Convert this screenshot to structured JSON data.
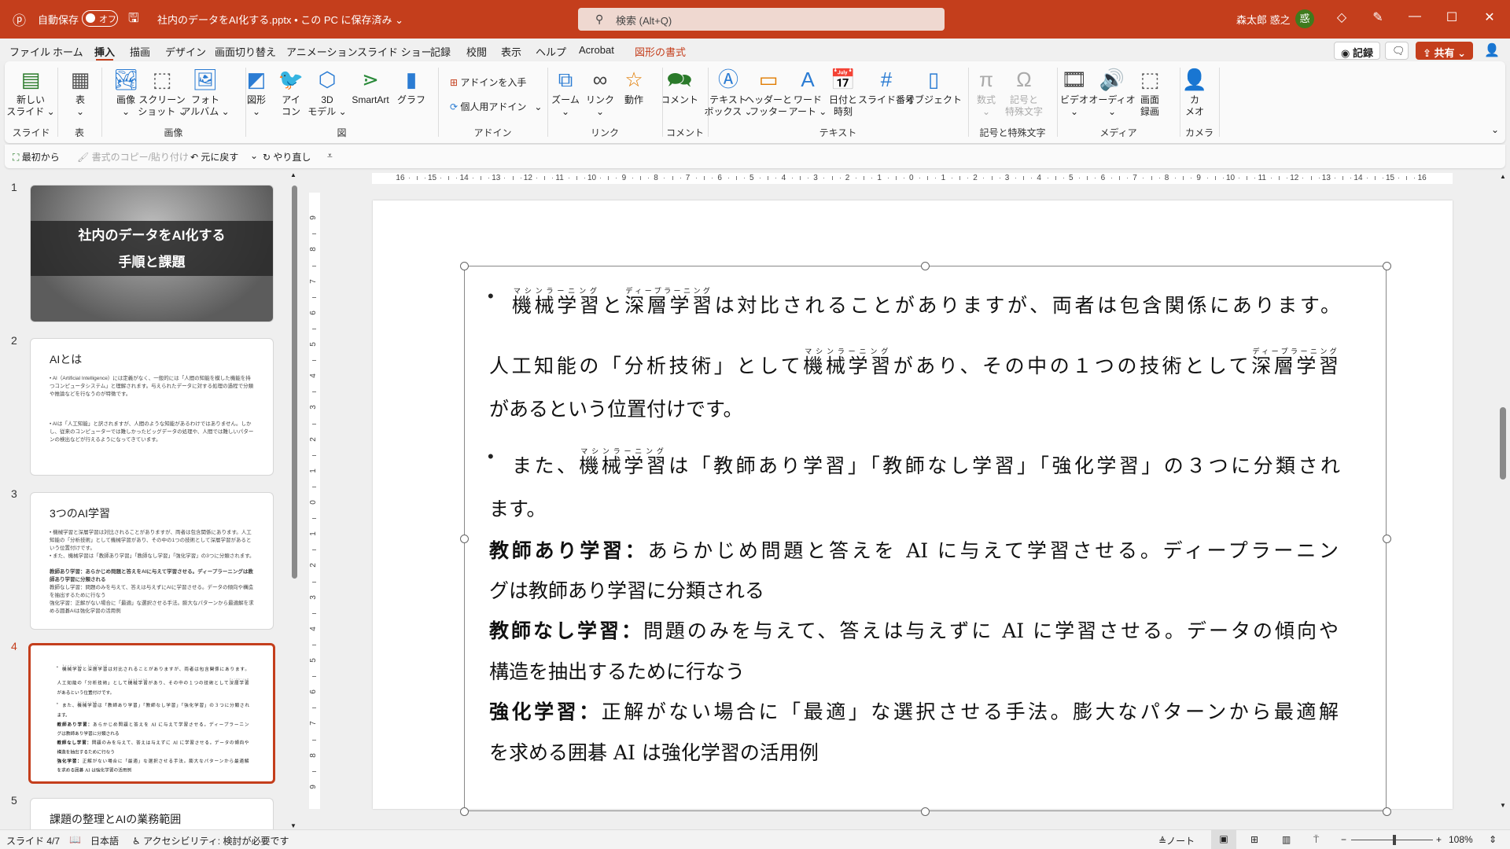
{
  "titlebar": {
    "autosave_label": "自動保存",
    "autosave_state": "オフ",
    "filename": "社内のデータをAI化する.pptx • この PC に保存済み ⌄",
    "search_placeholder": "検索 (Alt+Q)",
    "user_name": "森太郎 惑之",
    "avatar_text": "惑"
  },
  "menu": {
    "tabs": [
      "ファイル",
      "ホーム",
      "挿入",
      "描画",
      "デザイン",
      "画面切り替え",
      "アニメーション",
      "スライド ショー",
      "記録",
      "校閲",
      "表示",
      "ヘルプ",
      "Acrobat",
      "図形の書式"
    ],
    "active_tab": "挿入",
    "record_label": "記録",
    "share_label": "共有"
  },
  "ribbon": {
    "buttons": [
      {
        "label": "新しい\nスライド ⌄",
        "icon": "new-slide-icon"
      },
      {
        "label": "表\n⌄",
        "icon": "table-icon"
      },
      {
        "label": "画像\n⌄",
        "icon": "image-icon"
      },
      {
        "label": "スクリーン\nショット ⌄",
        "icon": "screenshot-icon"
      },
      {
        "label": "フォト\nアルバム ⌄",
        "icon": "photo-album-icon"
      },
      {
        "label": "図形\n⌄",
        "icon": "shapes-icon"
      },
      {
        "label": "アイ\nコン",
        "icon": "icons-icon"
      },
      {
        "label": "3D\nモデル ⌄",
        "icon": "3d-model-icon"
      },
      {
        "label": "SmartArt",
        "icon": "smartart-icon"
      },
      {
        "label": "グラフ",
        "icon": "chart-icon"
      },
      {
        "label": "ズーム\n⌄",
        "icon": "zoom-icon"
      },
      {
        "label": "リンク\n⌄",
        "icon": "link-icon"
      },
      {
        "label": "動作",
        "icon": "action-icon"
      },
      {
        "label": "コメント",
        "icon": "comment-icon"
      },
      {
        "label": "テキスト\nボックス ⌄",
        "icon": "textbox-icon"
      },
      {
        "label": "ヘッダーと\nフッター",
        "icon": "header-footer-icon"
      },
      {
        "label": "ワード\nアート ⌄",
        "icon": "wordart-icon"
      },
      {
        "label": "日付と\n時刻",
        "icon": "date-time-icon"
      },
      {
        "label": "スライド番号",
        "icon": "slide-number-icon"
      },
      {
        "label": "オブジェクト",
        "icon": "object-icon"
      },
      {
        "label": "数式\n⌄",
        "icon": "equation-icon"
      },
      {
        "label": "記号と\n特殊文字",
        "icon": "symbol-icon"
      },
      {
        "label": "ビデオ\n⌄",
        "icon": "video-icon"
      },
      {
        "label": "オーディオ\n⌄",
        "icon": "audio-icon"
      },
      {
        "label": "画面\n録画",
        "icon": "screen-recording-icon"
      },
      {
        "label": "カ\nメオ",
        "icon": "cameo-icon"
      }
    ],
    "addin_get": "アドインを入手",
    "addin_personal": "個人用アドイン",
    "groups": [
      "スライド",
      "表",
      "画像",
      "図",
      "アドイン",
      "リンク",
      "コメント",
      "テキスト",
      "記号と特殊文字",
      "メディア",
      "カメラ"
    ]
  },
  "qat": {
    "from_start": "最初から",
    "format_painter": "書式のコピー/貼り付け",
    "undo": "元に戻す",
    "redo": "やり直し"
  },
  "slides_panel": {
    "slides": [
      {
        "number": "1",
        "title_line1": "社内のデータをAI化する",
        "title_line2": "手順と課題"
      },
      {
        "number": "2",
        "title": "AIとは",
        "bullets": [
          "• AI（Artificial Intelligence）には定義がなく、一般的には「人間の知能を模した機能を持つコンピュータシステム」と理解されます。与えられたデータに対する処理の過程で分類や推論などを行なうのが特徴です。",
          "• AIは「人工知能」と訳されますが、人間のような知能があるわけではありません。しかし、従来のコンピューターでは難しかったビッグデータの処理や、人間では難しいパターンの検出などが行えるようになってきています。"
        ]
      },
      {
        "number": "3",
        "title": "3つのAI学習",
        "bullets": [
          "• 機械学習と深層学習は対比されることがありますが、両者は包含関係にあります。人工知能の「分析技術」として機械学習があり、その中の1つの技術として深層学習があるという位置付けです。",
          "• また、機械学習は「教師あり学習」「教師なし学習」「強化学習」の3つに分類されます。",
          "教師あり学習：あらかじめ問題と答えをAIに与えて学習させる。ディープラーニングは教師あり学習に分類される",
          "教師なし学習：問題のみを与えて、答えは与えずにAIに学習させる。データの傾向や構造を抽出するために行なう",
          "強化学習：正解がない場合に「最適」な選択させる手法。膨大なパターンから最適解を求める囲碁AIは強化学習の活用例"
        ]
      },
      {
        "number": "4"
      },
      {
        "number": "5",
        "title": "課題の整理とAIの業務範囲"
      }
    ]
  },
  "ruler": {
    "h_max": 16,
    "v_max": 9
  },
  "slide": {
    "lines": [
      {
        "bullet": true,
        "justify": true,
        "segs": [
          {
            "t": "機械学習",
            "r": "マシンラーニング"
          },
          {
            "t": "と"
          },
          {
            "t": "深層学習",
            "r": "ディープラーニング"
          },
          {
            "t": "は対比されることがありますが、両者は包含関係にあります。"
          }
        ]
      },
      {
        "justify": true,
        "segs": [
          {
            "t": "人工知能の「分析技術」として"
          },
          {
            "t": "機械学習",
            "r": "マシンラーニング"
          },
          {
            "t": "があり、その中の１つの技術として"
          },
          {
            "t": "深層学習",
            "r": "ディープラーニング"
          }
        ]
      },
      {
        "segs": [
          {
            "t": "があるという位置付けです。"
          }
        ]
      },
      {
        "bullet": true,
        "justify": true,
        "segs": [
          {
            "t": "また、"
          },
          {
            "t": "機械学習",
            "r": "マシンラーニング"
          },
          {
            "t": "は「教師あり学習」「教師なし学習」「強化学習」の３つに分類され"
          }
        ]
      },
      {
        "segs": [
          {
            "t": "ます。"
          }
        ]
      },
      {
        "justify": true,
        "segs": [
          {
            "t": "教師あり学習：",
            "b": true
          },
          {
            "t": "あらかじめ問題と答えを AI に与えて学習させる。ディープラーニン"
          }
        ]
      },
      {
        "segs": [
          {
            "t": "グは教師あり学習に分類される"
          }
        ]
      },
      {
        "justify": true,
        "segs": [
          {
            "t": "教師なし学習：",
            "b": true
          },
          {
            "t": "問題のみを与えて、答えは与えずに AI に学習させる。データの傾向や"
          }
        ]
      },
      {
        "segs": [
          {
            "t": "構造を抽出するために行なう"
          }
        ]
      },
      {
        "justify": true,
        "segs": [
          {
            "t": "強化学習：",
            "b": true
          },
          {
            "t": "正解がない場合に「最適」な選択させる手法。膨大なパターンから最適解"
          }
        ]
      },
      {
        "segs": [
          {
            "t": "を求める囲碁 AI は強化学習の活用例"
          }
        ]
      }
    ]
  },
  "status": {
    "slide_indicator": "スライド 4/7",
    "language": "日本語",
    "accessibility": "アクセシビリティ: 検討が必要です",
    "notes": "ノート",
    "zoom": "108%",
    "zoom_percent": 108
  },
  "colors": {
    "brand": "#c43e1c"
  }
}
